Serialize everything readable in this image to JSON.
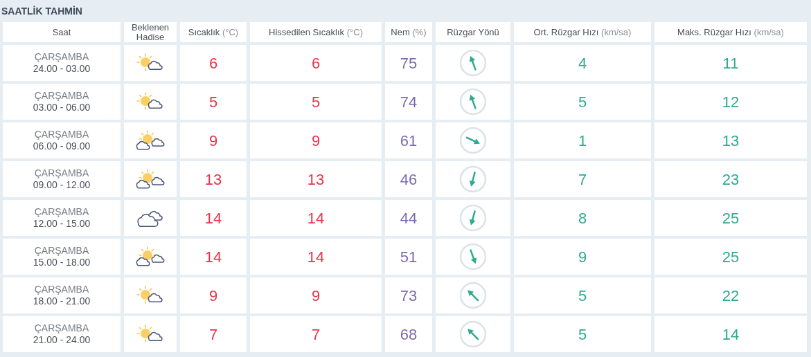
{
  "title": "SAATLİK TAHMİN",
  "columns": [
    {
      "label": "Saat"
    },
    {
      "label": "Beklenen Hadise"
    },
    {
      "label": "Sıcaklık",
      "unit": "(°C)"
    },
    {
      "label": "Hissedilen Sıcaklık",
      "unit": "(°C)"
    },
    {
      "label": "Nem",
      "unit": "(%)"
    },
    {
      "label": "Rüzgar Yönü"
    },
    {
      "label": "Ort. Rüzgar Hızı",
      "unit": "(km/sa)"
    },
    {
      "label": "Maks. Rüzgar Hızı",
      "unit": "(km/sa)"
    }
  ],
  "rows": [
    {
      "day": "ÇARŞAMBA",
      "hours": "24.00 - 03.00",
      "weather": {
        "kind": "sun-cloud"
      },
      "temp": "6",
      "feels": "6",
      "humidity": "75",
      "wind_arrow": {
        "kind": "nnw"
      },
      "wind": "4",
      "gust": "11"
    },
    {
      "day": "ÇARŞAMBA",
      "hours": "03.00 - 06.00",
      "weather": {
        "kind": "sun-cloud"
      },
      "temp": "5",
      "feels": "5",
      "humidity": "74",
      "wind_arrow": {
        "kind": "nnw"
      },
      "wind": "5",
      "gust": "12"
    },
    {
      "day": "ÇARŞAMBA",
      "hours": "06.00 - 09.00",
      "weather": {
        "kind": "sun-clouds"
      },
      "temp": "9",
      "feels": "9",
      "humidity": "61",
      "wind_arrow": {
        "kind": "ese"
      },
      "wind": "1",
      "gust": "13"
    },
    {
      "day": "ÇARŞAMBA",
      "hours": "09.00 - 12.00",
      "weather": {
        "kind": "sun-clouds"
      },
      "temp": "13",
      "feels": "13",
      "humidity": "46",
      "wind_arrow": {
        "kind": "ssw"
      },
      "wind": "7",
      "gust": "23"
    },
    {
      "day": "ÇARŞAMBA",
      "hours": "12.00 - 15.00",
      "weather": {
        "kind": "cloudy"
      },
      "temp": "14",
      "feels": "14",
      "humidity": "44",
      "wind_arrow": {
        "kind": "ssw"
      },
      "wind": "8",
      "gust": "25"
    },
    {
      "day": "ÇARŞAMBA",
      "hours": "15.00 - 18.00",
      "weather": {
        "kind": "sun-clouds"
      },
      "temp": "14",
      "feels": "14",
      "humidity": "51",
      "wind_arrow": {
        "kind": "sse"
      },
      "wind": "9",
      "gust": "25"
    },
    {
      "day": "ÇARŞAMBA",
      "hours": "18.00 - 21.00",
      "weather": {
        "kind": "sun-cloud"
      },
      "temp": "9",
      "feels": "9",
      "humidity": "73",
      "wind_arrow": {
        "kind": "nw"
      },
      "wind": "5",
      "gust": "22"
    },
    {
      "day": "ÇARŞAMBA",
      "hours": "21.00 - 24.00",
      "weather": {
        "kind": "sun-cloud"
      },
      "temp": "7",
      "feels": "7",
      "humidity": "68",
      "wind_arrow": {
        "kind": "nw"
      },
      "wind": "5",
      "gust": "14"
    }
  ]
}
